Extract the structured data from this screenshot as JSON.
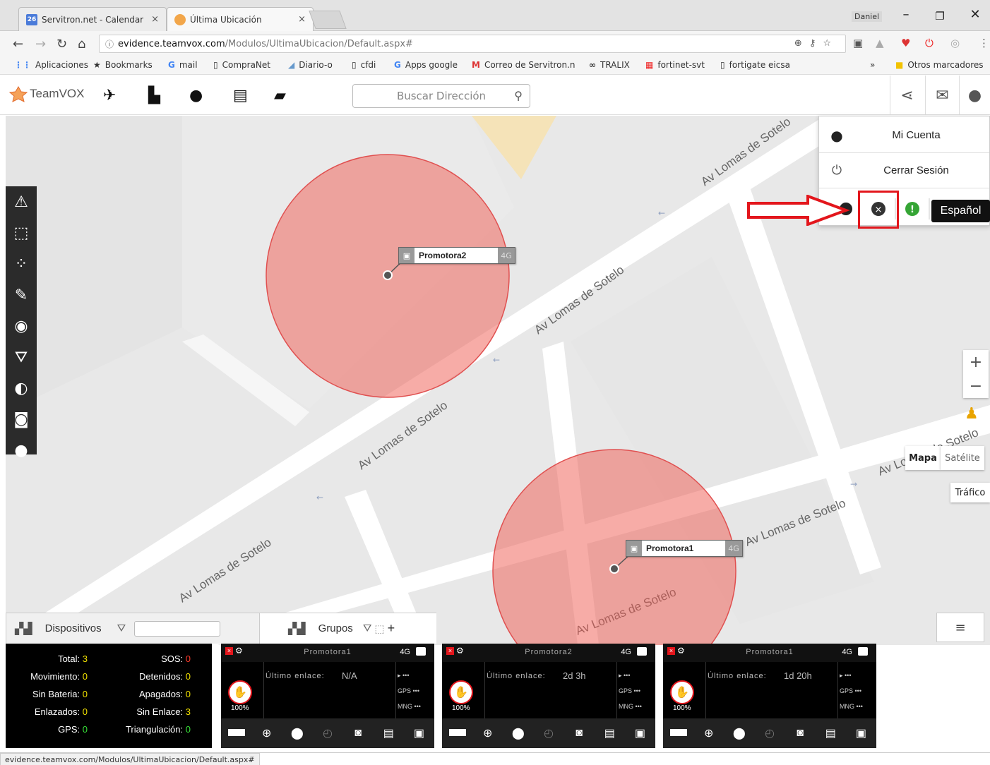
{
  "browser": {
    "tabs": [
      {
        "favicon": "26",
        "label": "Servitron.net - Calendar"
      },
      {
        "label": "Última Ubicación"
      }
    ],
    "user_badge": "Daniel",
    "url_host": "evidence.teamvox.com",
    "url_path": "/Modulos/UltimaUbicacion/Default.aspx#",
    "bookmarks": [
      "Aplicaciones",
      "Bookmarks",
      "mail",
      "CompraNet",
      "Diario-o",
      "cfdi",
      "Apps google",
      "Correo de Servitron.n",
      "TRALIX",
      "fortinet-svt",
      "fortigate eicsa"
    ],
    "bookmarks_more": "»",
    "other_bookmarks": "Otros marcadores",
    "status_url": "evidence.teamvox.com/Modulos/UltimaUbicacion/Default.aspx#"
  },
  "app": {
    "logo_text": "TeamVOX",
    "search_placeholder": "Buscar Dirección"
  },
  "user_menu": {
    "account_label": "Mi Cuenta",
    "logout_label": "Cerrar Sesión",
    "language": "Español"
  },
  "map": {
    "streets": [
      "Av Lomas de Sotelo"
    ],
    "markers": [
      {
        "name": "Promotora2",
        "net": "4G"
      },
      {
        "name": "Promotora1",
        "net": "4G"
      }
    ],
    "map_type_mapa": "Mapa",
    "map_type_satelite": "Satélite",
    "traffic": "Tráfico",
    "zoom_in": "+",
    "zoom_out": "−"
  },
  "bottom": {
    "devices_tab": "Dispositivos",
    "groups_tab": "Grupos"
  },
  "stats": {
    "total_label": "Total:",
    "total": "3",
    "sos_label": "SOS:",
    "sos": "0",
    "movimiento_label": "Movimiento:",
    "movimiento": "0",
    "detenidos_label": "Detenidos:",
    "detenidos": "0",
    "sin_bateria_label": "Sin Bateria:",
    "sin_bateria": "0",
    "apagados_label": "Apagados:",
    "apagados": "0",
    "enlazados_label": "Enlazados:",
    "enlazados": "0",
    "sin_enlace_label": "Sin Enlace:",
    "sin_enlace": "3",
    "gps_label": "GPS:",
    "gps": "0",
    "triangulacion_label": "Triangulación:",
    "triangulacion": "0"
  },
  "device_cards": [
    {
      "name": "Promotora1",
      "net": "4G",
      "last_link_label": "Último enlace:",
      "last_link": "N/A",
      "battery": "100%",
      "gps_label": "GPS",
      "mng_label": "MNG"
    },
    {
      "name": "Promotora2",
      "net": "4G",
      "last_link_label": "Último enlace:",
      "last_link": "2d 3h",
      "battery": "100%",
      "gps_label": "GPS",
      "mng_label": "MNG"
    },
    {
      "name": "Promotora1",
      "net": "4G",
      "last_link_label": "Último enlace:",
      "last_link": "1d 20h",
      "battery": "100%",
      "gps_label": "GPS",
      "mng_label": "MNG"
    }
  ]
}
